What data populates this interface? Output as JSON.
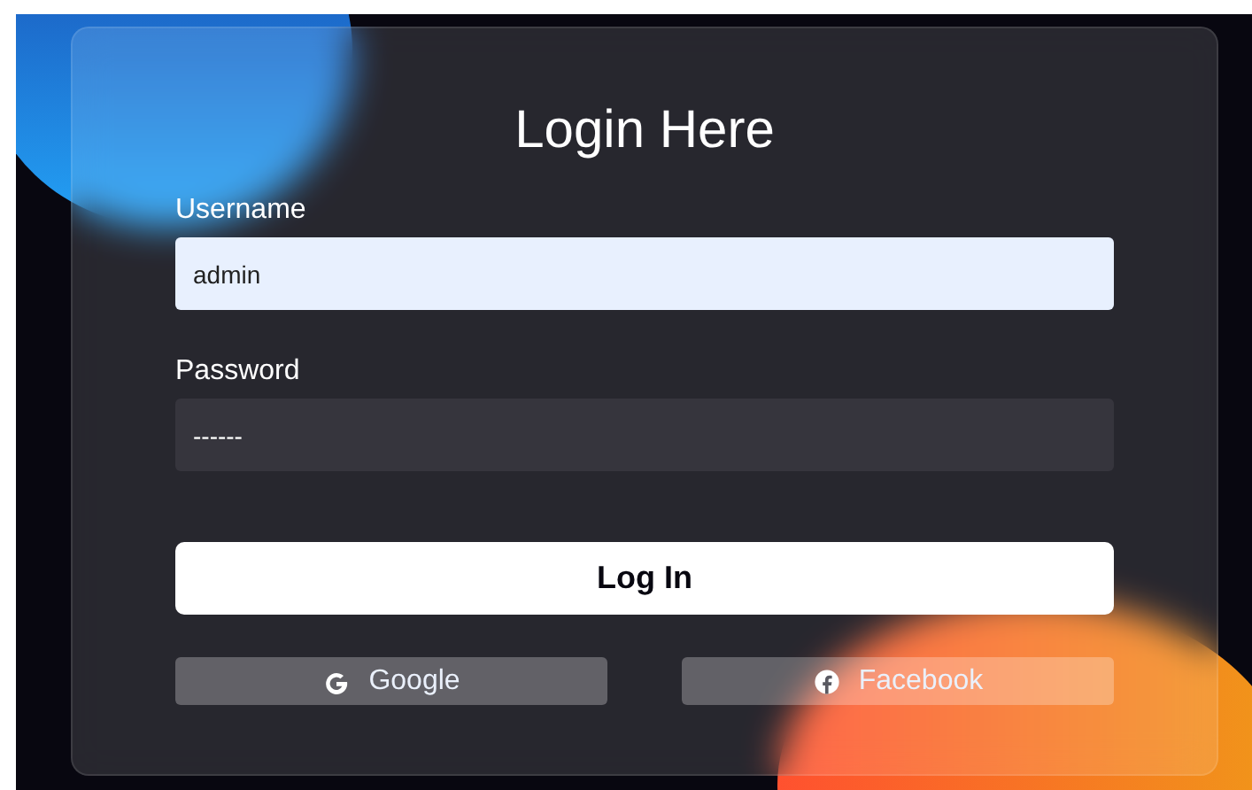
{
  "title": "Login Here",
  "fields": [
    {
      "label": "Username",
      "value": "admin",
      "kind": "text"
    },
    {
      "label": "Password",
      "value": "------",
      "kind": "password"
    }
  ],
  "submit": "Log In",
  "social": [
    {
      "label": "Google",
      "kind": "google"
    },
    {
      "label": "Facebook",
      "kind": "facebook"
    }
  ]
}
